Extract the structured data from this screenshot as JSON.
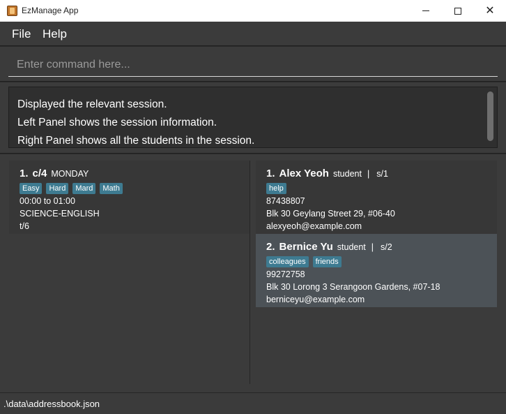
{
  "window": {
    "title": "EzManage App",
    "close_glyph": "✕"
  },
  "menu": {
    "items": [
      "File",
      "Help"
    ]
  },
  "command": {
    "placeholder": "Enter command here..."
  },
  "result": {
    "lines": [
      "Displayed the relevant session.",
      "Left Panel shows the session information.",
      "Right Panel shows all the students in the session."
    ]
  },
  "session": {
    "index": "1.",
    "code": "c/4",
    "day": "MONDAY",
    "tags": [
      "Easy",
      "Hard",
      "Mard",
      "Math"
    ],
    "time": "00:00 to 01:00",
    "subject": "SCIENCE-ENGLISH",
    "tutor": "t/6"
  },
  "students": [
    {
      "index": "1.",
      "name": "Alex Yeoh",
      "role": "student",
      "separator": "|",
      "id": "s/1",
      "tags": [
        "help"
      ],
      "phone": "87438807",
      "address": "Blk 30 Geylang Street 29, #06-40",
      "email": "alexyeoh@example.com"
    },
    {
      "index": "2.",
      "name": "Bernice Yu",
      "role": "student",
      "separator": "|",
      "id": "s/2",
      "tags": [
        "colleagues",
        "friends"
      ],
      "phone": "99272758",
      "address": "Blk 30 Lorong 3 Serangoon Gardens, #07-18",
      "email": "berniceyu@example.com"
    }
  ],
  "status": {
    "path": ".\\data\\addressbook.json"
  },
  "colors": {
    "background": "#3b3b3b",
    "tag": "#3e7b91",
    "selected_card": "#4c5257"
  }
}
